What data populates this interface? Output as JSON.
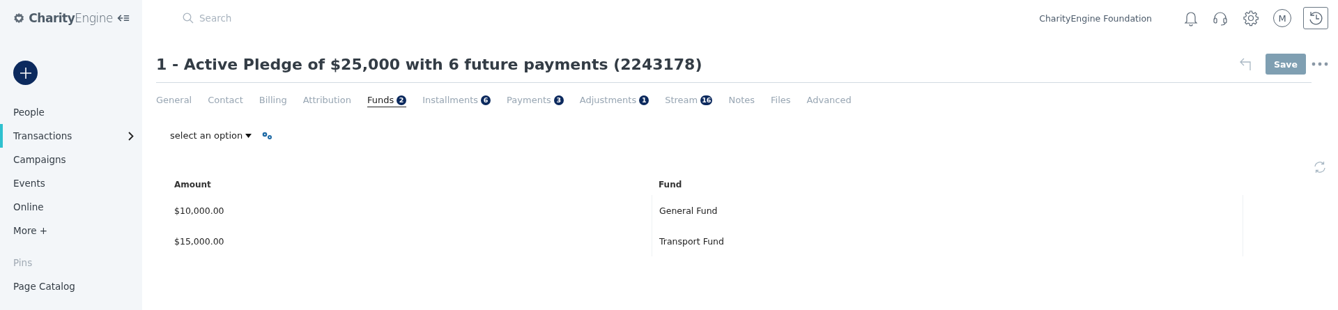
{
  "brand": {
    "name_bold": "Charity",
    "name_light": "Engine"
  },
  "sidebar": {
    "items": [
      {
        "label": "People",
        "selected": false,
        "has_submenu": false
      },
      {
        "label": "Transactions",
        "selected": true,
        "has_submenu": true
      },
      {
        "label": "Campaigns",
        "selected": false,
        "has_submenu": false
      },
      {
        "label": "Events",
        "selected": false,
        "has_submenu": false
      },
      {
        "label": "Online",
        "selected": false,
        "has_submenu": false
      },
      {
        "label": "More +",
        "selected": false,
        "has_submenu": false
      }
    ],
    "pins_heading": "Pins",
    "pins": [
      "Page Catalog"
    ]
  },
  "topbar": {
    "search_placeholder": "Search",
    "organization": "CharityEngine Foundation",
    "avatar": "M"
  },
  "record": {
    "title": "1 - Active Pledge of $25,000 with 6 future payments (2243178)",
    "save": "Save"
  },
  "tabs": [
    {
      "label": "General",
      "selected": false
    },
    {
      "label": "Contact",
      "selected": false
    },
    {
      "label": "Billing",
      "selected": false
    },
    {
      "label": "Attribution",
      "selected": false
    },
    {
      "label": "Funds",
      "count": "2",
      "selected": true
    },
    {
      "label": "Installments",
      "count": "6",
      "selected": false
    },
    {
      "label": "Payments",
      "count": "3",
      "selected": false
    },
    {
      "label": "Adjustments",
      "count": "1",
      "selected": false
    },
    {
      "label": "Stream",
      "count": "16",
      "selected": false
    },
    {
      "label": "Notes",
      "selected": false
    },
    {
      "label": "Files",
      "selected": false
    },
    {
      "label": "Advanced",
      "selected": false
    }
  ],
  "toolbar": {
    "select": "select an option"
  },
  "table": {
    "columns": [
      "Amount",
      "Fund"
    ],
    "rows": [
      [
        "$10,000.00",
        "General Fund"
      ],
      [
        "$15,000.00",
        "Transport Fund"
      ]
    ]
  }
}
